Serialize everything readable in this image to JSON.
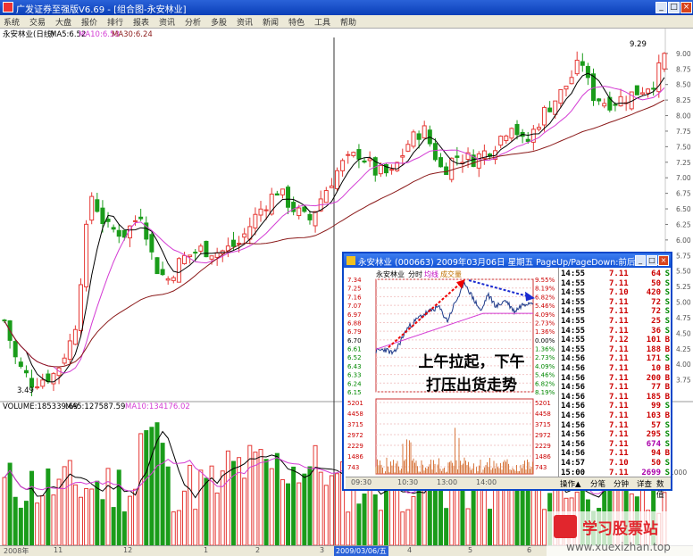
{
  "window": {
    "title": "广发证券至强版V6.69 - [组合图-永安林业]",
    "minimize": "_",
    "restore": "□",
    "close": "×"
  },
  "menu": [
    "系统",
    "交易",
    "大盘",
    "报价",
    "排行",
    "报表",
    "资讯",
    "分析",
    "多股",
    "资讯",
    "新闻",
    "特色",
    "工具",
    "帮助"
  ],
  "stock": {
    "label": "永安林业(日线)",
    "ma5": "MA5:6.52",
    "ma10": "MA10:6.53",
    "ma30": "MA30:6.24",
    "high_label": "9.29",
    "low_label": "3.49"
  },
  "price_axis": [
    "9.00",
    "8.75",
    "8.50",
    "8.25",
    "8.00",
    "7.75",
    "7.50",
    "7.25",
    "7.00",
    "6.75",
    "6.50",
    "6.25",
    "6.00",
    "5.75",
    "5.50",
    "5.25",
    "5.00",
    "4.75",
    "4.50",
    "4.25",
    "4.00",
    "3.75"
  ],
  "volume": {
    "label": "VOLUME:185339.69",
    "ma5": "MA5:127587.59",
    "ma10": "MA10:134176.02",
    "axis": [
      "1000"
    ]
  },
  "date_axis": [
    {
      "label": "2008年",
      "selected": false
    },
    {
      "label": "11",
      "selected": false
    },
    {
      "label": "12",
      "selected": false
    },
    {
      "label": "1",
      "selected": false
    },
    {
      "label": "2",
      "selected": false
    },
    {
      "label": "3",
      "selected": false
    },
    {
      "label": "2009/03/06/五",
      "selected": true
    },
    {
      "label": "4",
      "selected": false
    },
    {
      "label": "5",
      "selected": false
    },
    {
      "label": "6",
      "selected": false
    }
  ],
  "popup": {
    "title": "永安林业 (000663)  2009年03月06日  星期五  PageUp/PageDown:前后日  +:...",
    "chart_label": "永安林业",
    "tab_time": "分时",
    "tab_avg": "均线",
    "tab_vol": "成交量",
    "price_axis_left": [
      "7.34",
      "7.25",
      "7.16",
      "7.07",
      "6.97",
      "6.88",
      "6.79",
      "6.70",
      "6.61",
      "6.52",
      "6.43",
      "6.33",
      "6.24",
      "6.15"
    ],
    "price_axis_right": [
      "9.55%",
      "8.19%",
      "6.82%",
      "5.46%",
      "4.09%",
      "2.73%",
      "1.36%",
      "0.00%",
      "1.36%",
      "2.73%",
      "4.09%",
      "5.46%",
      "6.82%",
      "8.19%"
    ],
    "vol_axis_left": [
      "5201",
      "4458",
      "3715",
      "2972",
      "2229",
      "1486",
      "743"
    ],
    "vol_axis_right": [
      "5201",
      "4458",
      "3715",
      "2972",
      "2229",
      "1486",
      "743"
    ],
    "time_axis": [
      "09:30",
      "10:30",
      "13:00",
      "14:00"
    ],
    "ticks": [
      {
        "time": "14:55",
        "price": "7.11",
        "vol": "64",
        "side": "S",
        "purple": false
      },
      {
        "time": "14:55",
        "price": "7.11",
        "vol": "50",
        "side": "S",
        "purple": false
      },
      {
        "time": "14:55",
        "price": "7.10",
        "vol": "420",
        "side": "S",
        "purple": false
      },
      {
        "time": "14:55",
        "price": "7.11",
        "vol": "72",
        "side": "S",
        "purple": false
      },
      {
        "time": "14:55",
        "price": "7.11",
        "vol": "72",
        "side": "S",
        "purple": false
      },
      {
        "time": "14:55",
        "price": "7.11",
        "vol": "25",
        "side": "S",
        "purple": false
      },
      {
        "time": "14:55",
        "price": "7.11",
        "vol": "36",
        "side": "S",
        "purple": false
      },
      {
        "time": "14:55",
        "price": "7.12",
        "vol": "101",
        "side": "B",
        "purple": false
      },
      {
        "time": "14:55",
        "price": "7.11",
        "vol": "188",
        "side": "B",
        "purple": false
      },
      {
        "time": "14:56",
        "price": "7.11",
        "vol": "171",
        "side": "S",
        "purple": false
      },
      {
        "time": "14:56",
        "price": "7.11",
        "vol": "10",
        "side": "B",
        "purple": false
      },
      {
        "time": "14:56",
        "price": "7.11",
        "vol": "200",
        "side": "B",
        "purple": false
      },
      {
        "time": "14:56",
        "price": "7.11",
        "vol": "77",
        "side": "B",
        "purple": false
      },
      {
        "time": "14:56",
        "price": "7.11",
        "vol": "185",
        "side": "B",
        "purple": false
      },
      {
        "time": "14:56",
        "price": "7.11",
        "vol": "99",
        "side": "S",
        "purple": false
      },
      {
        "time": "14:56",
        "price": "7.11",
        "vol": "103",
        "side": "B",
        "purple": false
      },
      {
        "time": "14:56",
        "price": "7.11",
        "vol": "57",
        "side": "S",
        "purple": false
      },
      {
        "time": "14:56",
        "price": "7.11",
        "vol": "295",
        "side": "S",
        "purple": false
      },
      {
        "time": "14:56",
        "price": "7.11",
        "vol": "674",
        "side": "S",
        "purple": true
      },
      {
        "time": "14:56",
        "price": "7.11",
        "vol": "94",
        "side": "B",
        "purple": false
      },
      {
        "time": "14:57",
        "price": "7.10",
        "vol": "50",
        "side": "S",
        "purple": false
      },
      {
        "time": "15:00",
        "price": "7.11",
        "vol": "2699",
        "side": "S",
        "purple": true
      }
    ],
    "tabs": [
      "操作▲",
      "分笔",
      "分钟",
      "详查",
      "数值"
    ]
  },
  "annotation": {
    "line1": "上午拉起，下午",
    "line2": "打压出货走势"
  },
  "watermark": {
    "brand": "学习股票站",
    "url": "www.xuexizhan.top"
  },
  "colors": {
    "up": "#e53935",
    "down": "#1a9c1a",
    "ma5": "#000000",
    "ma10": "#d43cd4",
    "ma30": "#8b1a1a",
    "accent": "#0a47c9"
  }
}
